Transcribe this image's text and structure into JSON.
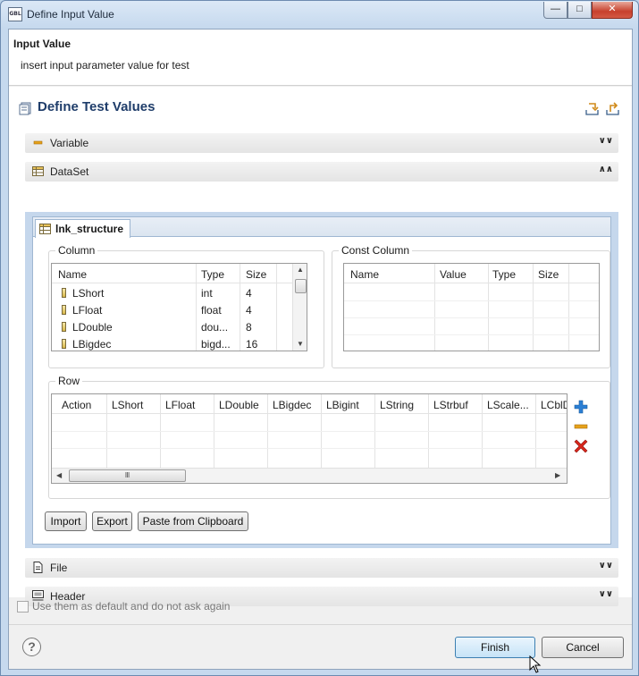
{
  "window": {
    "app_icon_text": "GBL",
    "title": "Define Input Value",
    "controls": {
      "minimize": "—",
      "maximize": "□",
      "close": "✕"
    }
  },
  "header": {
    "title": "Input Value",
    "subtitle": "insert input parameter value for test"
  },
  "form": {
    "title": "Define Test Values",
    "toolbar": [
      {
        "icon": "import-icon"
      },
      {
        "icon": "export-icon"
      }
    ]
  },
  "sections": {
    "variable": {
      "label": "Variable",
      "icon": "variable-icon",
      "expanded": false
    },
    "dataset": {
      "label": "DataSet",
      "icon": "table-icon",
      "expanded": true
    },
    "file": {
      "label": "File",
      "icon": "file-icon",
      "expanded": false
    },
    "header": {
      "label": "Header",
      "icon": "header-icon",
      "expanded": false
    }
  },
  "dataset": {
    "tab_label": "lnk_structure",
    "column_group": {
      "title": "Column",
      "headers": [
        "Name",
        "Type",
        "Size"
      ],
      "rows": [
        {
          "name": "LShort",
          "type": "int",
          "size": "4"
        },
        {
          "name": "LFloat",
          "type": "float",
          "size": "4"
        },
        {
          "name": "LDouble",
          "type": "dou...",
          "size": "8"
        },
        {
          "name": "LBigdec",
          "type": "bigd...",
          "size": "16"
        }
      ]
    },
    "const_group": {
      "title": "Const Column",
      "headers": [
        "Name",
        "Value",
        "Type",
        "Size"
      ]
    },
    "row_group": {
      "title": "Row",
      "headers": [
        "Action",
        "LShort",
        "LFloat",
        "LDouble",
        "LBigdec",
        "LBigint",
        "LString",
        "LStrbuf",
        "LScale...",
        "LCblD"
      ],
      "scroll_grip": "Ⅲ"
    },
    "buttons": {
      "import": "Import",
      "export": "Export",
      "paste": "Paste from Clipboard"
    }
  },
  "footer": {
    "checkbox_label": "Use them as default and do not ask again",
    "checkbox_checked": false,
    "help": "?",
    "finish": "Finish",
    "cancel": "Cancel"
  },
  "colors": {
    "form_title": "#1f3d6a",
    "dataset_frame": "#c5d7ec",
    "add_icon": "#2b7fd4",
    "remove_icon": "#e6a21a",
    "delete_icon": "#d9261c"
  }
}
